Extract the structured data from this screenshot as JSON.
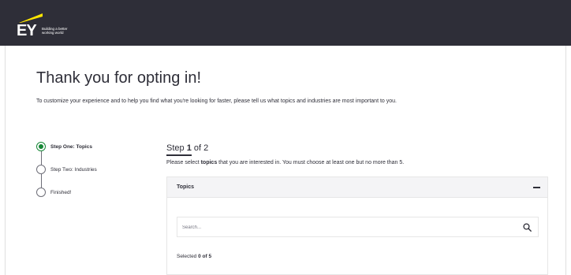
{
  "header": {
    "logo_text": "EY",
    "logo_tagline": "Building a better\nworking world",
    "background_color": "#2e2e38",
    "brand_yellow": "#ffe600"
  },
  "main": {
    "title": "Thank you for opting in!",
    "intro": "To customize your experience and to help you find what you're looking for faster, please tell us what topics and industries are most important to you."
  },
  "stepper": {
    "active_color": "#168736",
    "steps": [
      {
        "label": "Step One: Topics",
        "state": "active"
      },
      {
        "label": "Step Two: Industries",
        "state": "pending"
      },
      {
        "label": "Finished!",
        "state": "pending"
      }
    ]
  },
  "step": {
    "prefix": "Step ",
    "current": "1",
    "suffix": " of 2",
    "instruction_before": "Please select ",
    "instruction_keyword": "topics",
    "instruction_after": " that you are interested in. You must choose at least one but no more than 5."
  },
  "topics_panel": {
    "title": "Topics",
    "collapse_icon": "minus-icon",
    "search_placeholder": "Search...",
    "search_value": "",
    "search_icon": "search-icon",
    "selected_prefix": "Selected ",
    "selected_count": "0 of 5"
  }
}
